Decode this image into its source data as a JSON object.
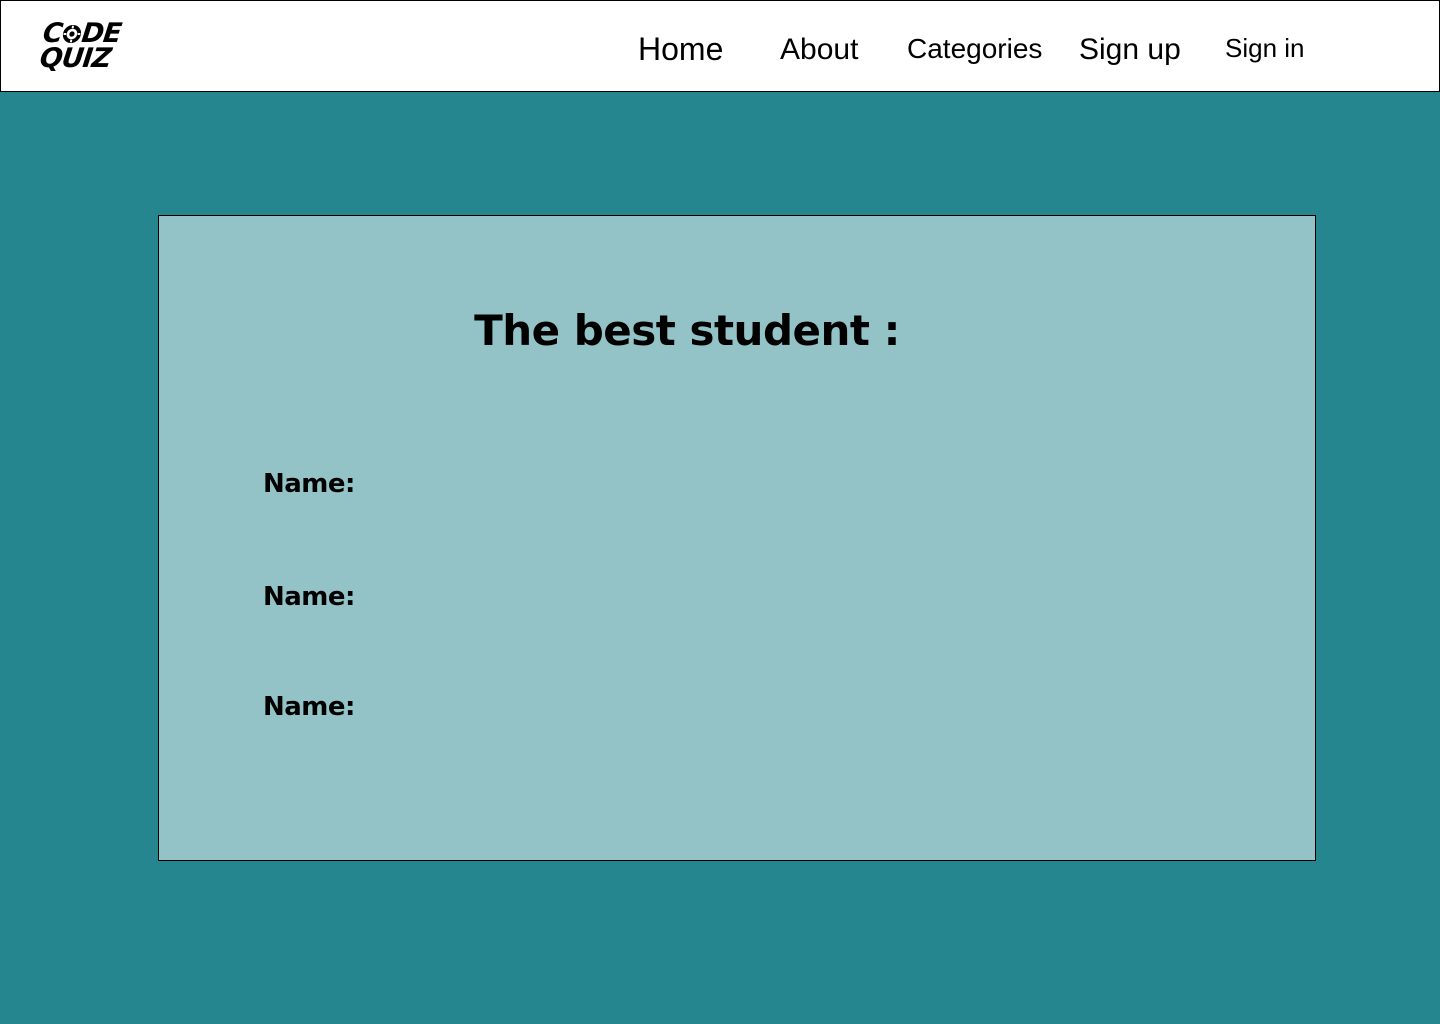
{
  "logo": {
    "line1_part1": "C",
    "line1_part2": "DE",
    "line2": "QUIZ"
  },
  "nav": {
    "home": "Home",
    "about": "About",
    "categories": "Categories",
    "signup": "Sign up",
    "signin": "Sign in"
  },
  "card": {
    "title": "The best student :",
    "entries": [
      {
        "label": "Name:"
      },
      {
        "label": "Name:"
      },
      {
        "label": "Name:"
      }
    ]
  },
  "colors": {
    "page_background": "#25868f",
    "card_background": "#93c3c7",
    "header_background": "#ffffff",
    "text": "#000000"
  },
  "icons": {
    "logo_gear": "gear-icon"
  }
}
